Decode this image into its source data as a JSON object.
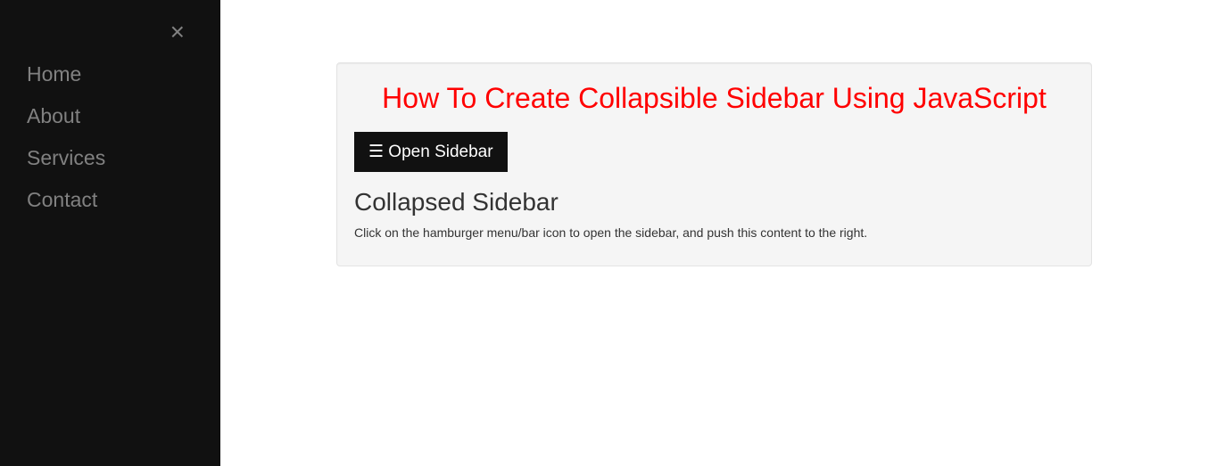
{
  "sidebar": {
    "close_label": "×",
    "items": [
      {
        "label": "Home"
      },
      {
        "label": "About"
      },
      {
        "label": "Services"
      },
      {
        "label": "Contact"
      }
    ]
  },
  "main": {
    "title": "How To Create Collapsible Sidebar Using JavaScript",
    "open_button": "☰ Open Sidebar",
    "subheading": "Collapsed Sidebar",
    "description": "Click on the hamburger menu/bar icon to open the sidebar, and push this content to the right."
  }
}
